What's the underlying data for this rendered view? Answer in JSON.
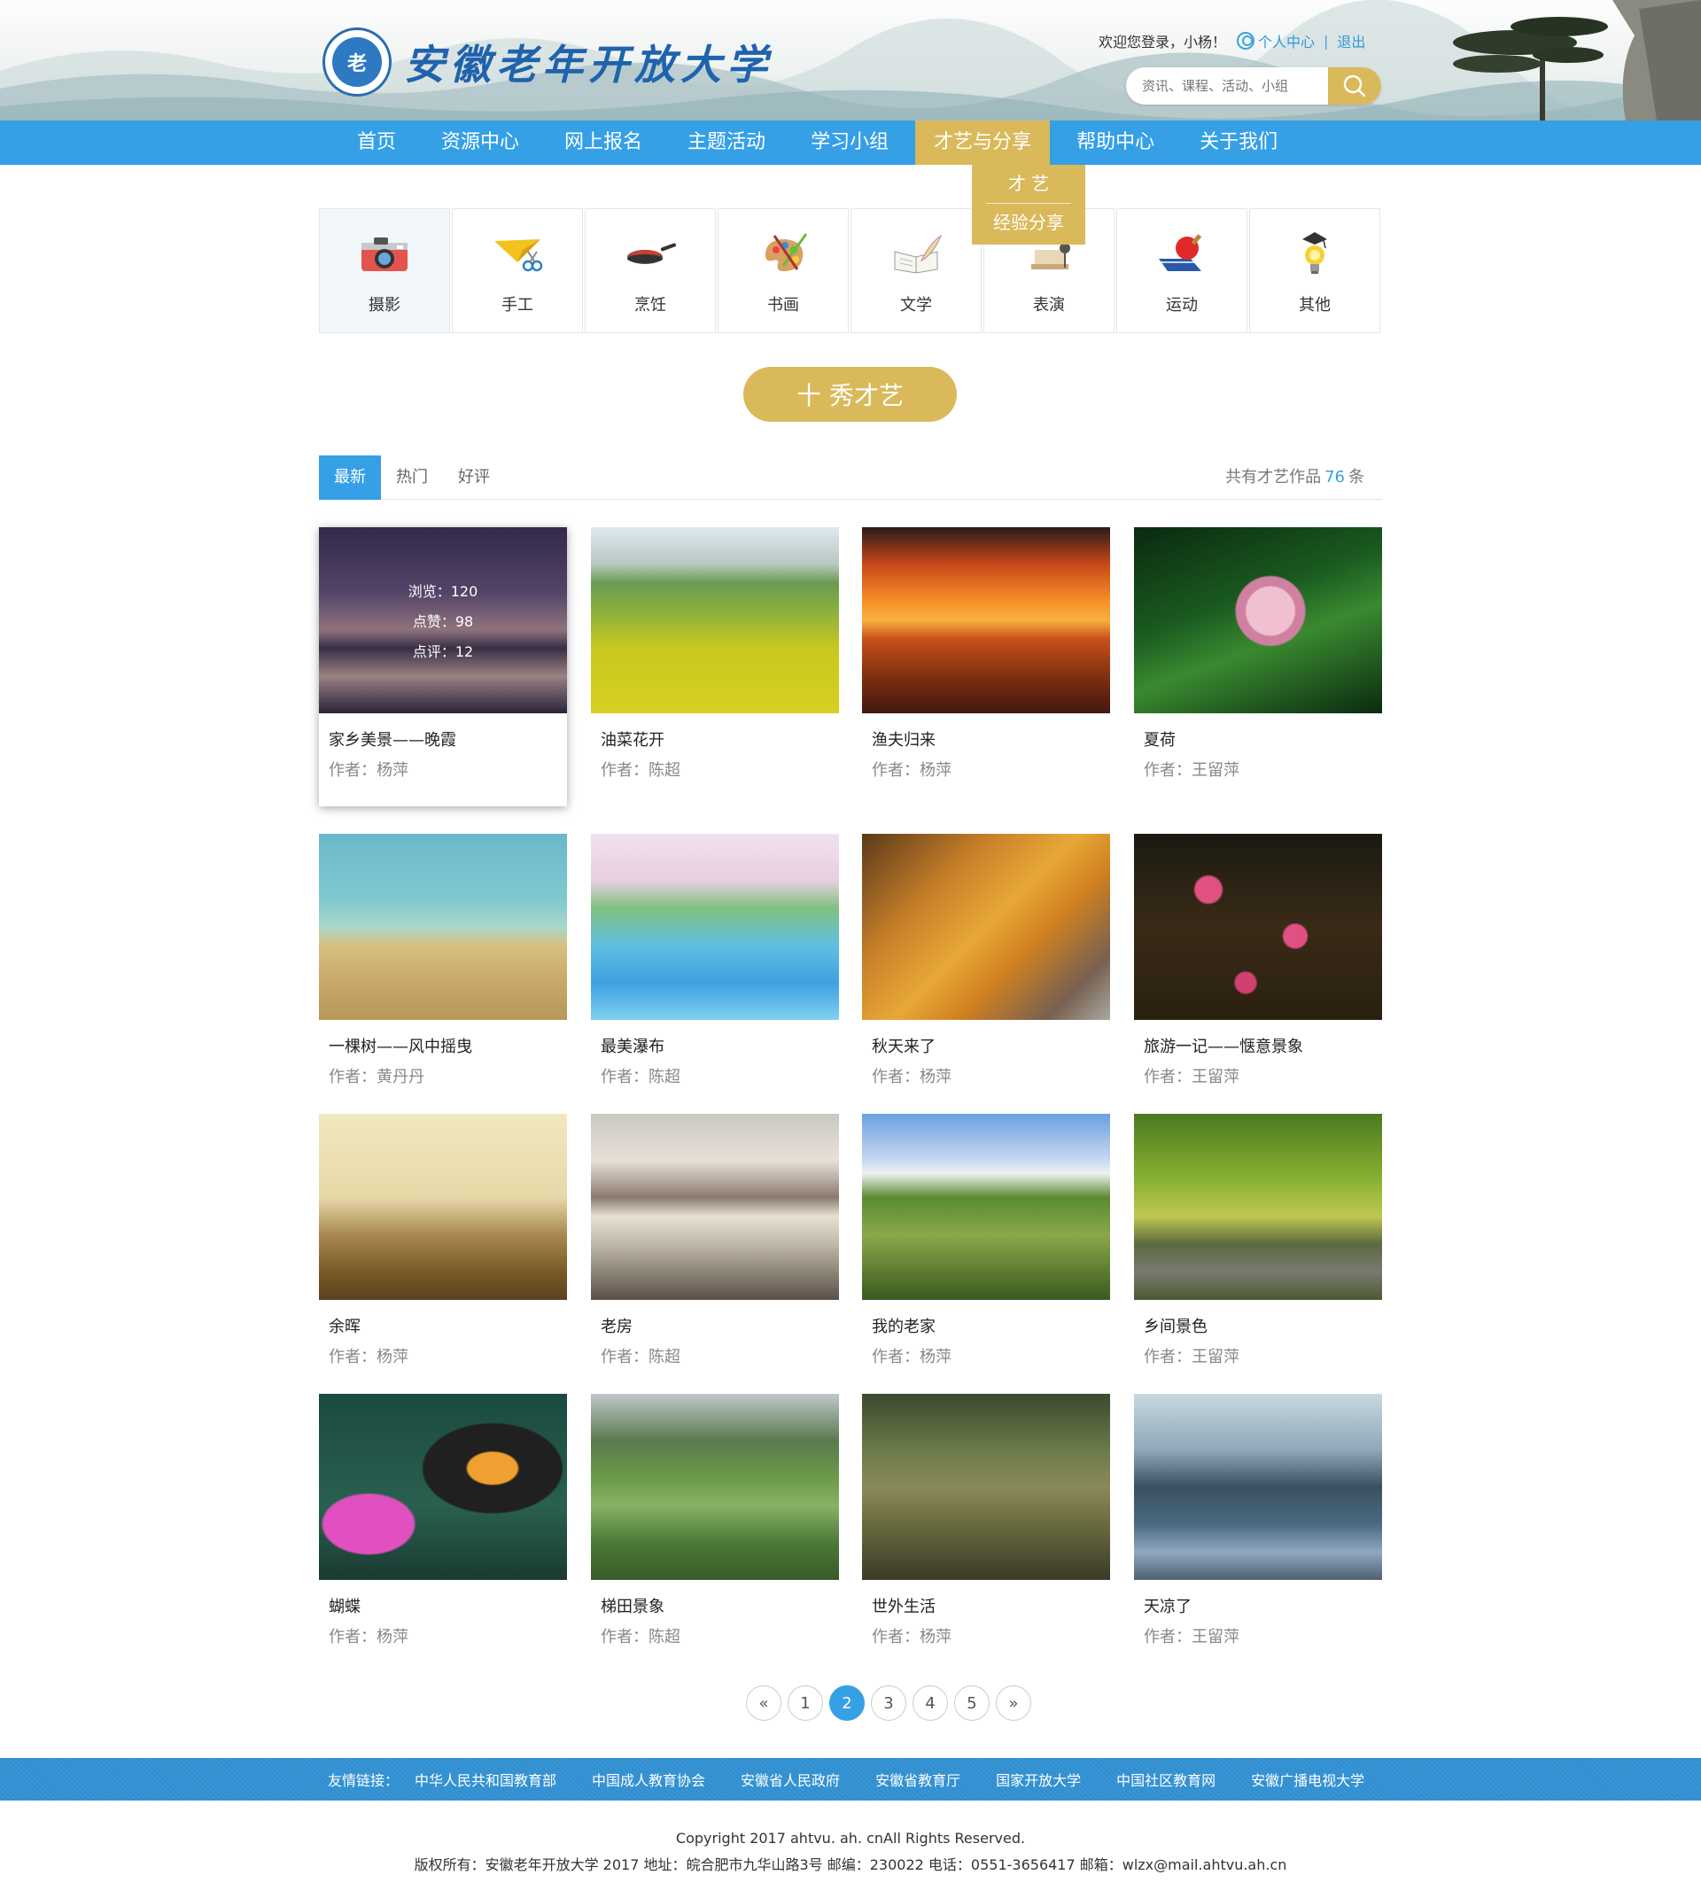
{
  "header": {
    "logo_emblem_text": "老",
    "site_name": "安徽老年开放大学",
    "welcome": "欢迎您登录，小杨！",
    "user_center": "个人中心",
    "separator": "|",
    "logout": "退出",
    "search_placeholder": "资讯、课程、活动、小组"
  },
  "nav": {
    "items": [
      {
        "label": "首页"
      },
      {
        "label": "资源中心"
      },
      {
        "label": "网上报名"
      },
      {
        "label": "主题活动"
      },
      {
        "label": "学习小组"
      },
      {
        "label": "才艺与分享",
        "active": true
      },
      {
        "label": "帮助中心"
      },
      {
        "label": "关于我们"
      }
    ],
    "dropdown": [
      "才 艺",
      "经验分享"
    ]
  },
  "categories": [
    {
      "label": "摄影",
      "icon": "camera-icon",
      "active": true
    },
    {
      "label": "手工",
      "icon": "paper-plane-icon"
    },
    {
      "label": "烹饪",
      "icon": "frying-pan-icon"
    },
    {
      "label": "书画",
      "icon": "palette-icon"
    },
    {
      "label": "文学",
      "icon": "book-quill-icon"
    },
    {
      "label": "表演",
      "icon": "stage-icon"
    },
    {
      "label": "运动",
      "icon": "ping-pong-icon"
    },
    {
      "label": "其他",
      "icon": "lightbulb-icon"
    }
  ],
  "show_button": "十 秀才艺",
  "tabs": [
    "最新",
    "热门",
    "好评"
  ],
  "count": {
    "prefix": "共有才艺作品",
    "number": "76",
    "suffix": "条"
  },
  "works": [
    {
      "title": "家乡美景——晚霞",
      "author": "作者：杨萍",
      "views": "浏览：120",
      "likes": "点赞：98",
      "comments": "点评：12"
    },
    {
      "title": "油菜花开",
      "author": "作者：陈超"
    },
    {
      "title": "渔夫归来",
      "author": "作者：杨萍"
    },
    {
      "title": "夏荷",
      "author": "作者：王留萍"
    },
    {
      "title": "一棵树——风中摇曳",
      "author": "作者：黄丹丹"
    },
    {
      "title": "最美瀑布",
      "author": "作者：陈超"
    },
    {
      "title": "秋天来了",
      "author": "作者：杨萍"
    },
    {
      "title": "旅游一记——惬意景象",
      "author": "作者：王留萍"
    },
    {
      "title": "余晖",
      "author": "作者：杨萍"
    },
    {
      "title": "老房",
      "author": "作者：陈超"
    },
    {
      "title": "我的老家",
      "author": "作者：杨萍"
    },
    {
      "title": "乡间景色",
      "author": "作者：王留萍"
    },
    {
      "title": "蝴蝶",
      "author": "作者：杨萍"
    },
    {
      "title": "梯田景象",
      "author": "作者：陈超"
    },
    {
      "title": "世外生活",
      "author": "作者：杨萍"
    },
    {
      "title": "天凉了",
      "author": "作者：王留萍"
    }
  ],
  "pagination": {
    "prev": "«",
    "pages": [
      "1",
      "2",
      "3",
      "4",
      "5"
    ],
    "current": "2",
    "next": "»"
  },
  "footer": {
    "links_label": "友情链接：",
    "links": [
      "中华人民共和国教育部",
      "中国成人教育协会",
      "安徽省人民政府",
      "安徽省教育厅",
      "国家开放大学",
      "中国社区教育网",
      "安徽广播电视大学"
    ],
    "copyright": "Copyright 2017 ahtvu. ah. cnAll Rights Reserved.",
    "address": "版权所有：安徽老年开放大学 2017 地址：皖合肥市九华山路3号 邮编：230022 电话：0551-3656417 邮箱：wlzx@mail.ahtvu.ah.cn"
  },
  "colors": {
    "primary": "#35a0e6",
    "gold": "#d9b95a"
  }
}
